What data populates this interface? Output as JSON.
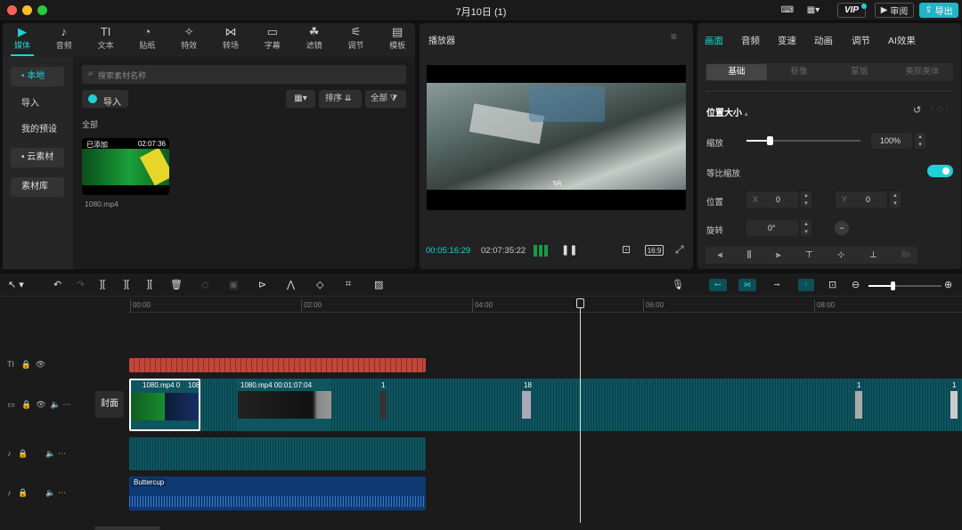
{
  "window": {
    "title": "7月10日 (1)",
    "vip": "VIP",
    "review": "审阅",
    "export": "导出"
  },
  "toolbar": {
    "items": [
      {
        "label": "媒体",
        "icon": "▶"
      },
      {
        "label": "音频",
        "icon": "♪"
      },
      {
        "label": "文本",
        "icon": "TI"
      },
      {
        "label": "贴纸",
        "icon": "◔"
      },
      {
        "label": "特效",
        "icon": "✧"
      },
      {
        "label": "转场",
        "icon": "⋈"
      },
      {
        "label": "字幕",
        "icon": "▭"
      },
      {
        "label": "滤镜",
        "icon": "☘"
      },
      {
        "label": "调节",
        "icon": "⚟"
      },
      {
        "label": "模板",
        "icon": "▤"
      }
    ]
  },
  "sidebar": {
    "items": [
      "• 本地",
      "导入",
      "我的预设",
      "• 云素材",
      "素材库"
    ]
  },
  "media": {
    "search_placeholder": "搜索素材名称",
    "import_label": "导入",
    "sort_label": "排序",
    "filter_label": "全部",
    "section_label": "全部",
    "clip": {
      "badge": "已添加",
      "duration": "02:07:36",
      "filename": "1080.mp4"
    }
  },
  "player": {
    "title": "播放器",
    "subtitle": "飞向",
    "current_time": "00:05:16:29",
    "total_time": "02:07:35:22",
    "ratio": "16:9"
  },
  "inspector": {
    "tabs": [
      "画面",
      "音频",
      "变速",
      "动画",
      "调节",
      "AI效果"
    ],
    "subtabs": [
      "基础",
      "抠像",
      "蒙版",
      "美颜美体"
    ],
    "section": "位置大小",
    "scale_label": "缩放",
    "scale_value": "100%",
    "scale_level": 0.2,
    "proportional_label": "等比缩放",
    "position_label": "位置",
    "x_label": "X",
    "x_value": "0",
    "y_label": "Y",
    "y_value": "0",
    "rotate_label": "旋转",
    "rotate_value": "0°"
  },
  "timeline": {
    "ticks": [
      "00:00",
      "02:00",
      "04:00",
      "06:00",
      "08:00"
    ],
    "cover_label": "封面",
    "clips": [
      {
        "label": "1080.mp4   0"
      },
      {
        "label": "108"
      },
      {
        "label": "1080.mp4   00:01:07:04"
      },
      {
        "label": "1"
      },
      {
        "label": "18"
      },
      {
        "label": "1"
      },
      {
        "label": "1"
      }
    ],
    "audio_label": "Buttercup"
  },
  "colors": {
    "accent": "#1fd1d6",
    "text_clip": "#c0483a",
    "video_clip": "#0f5560",
    "audio_clip": "#0d3a72"
  }
}
